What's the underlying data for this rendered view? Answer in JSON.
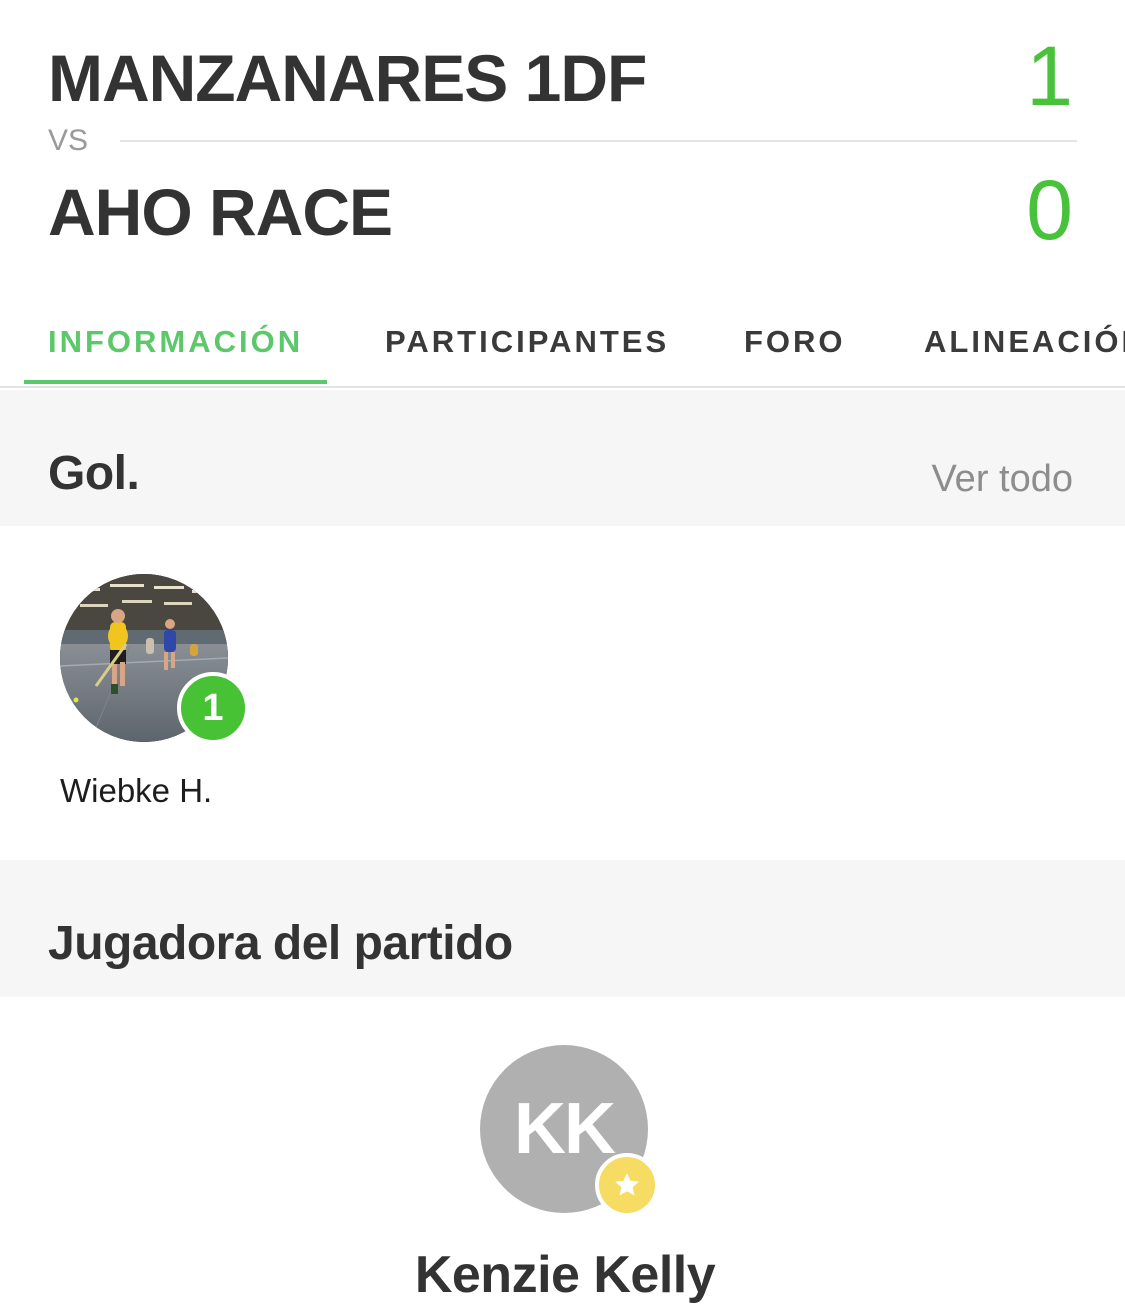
{
  "match": {
    "home_team": "MANZANARES 1DF",
    "home_score": "1",
    "vs_label": "VS",
    "away_team": "AHO RACE",
    "away_score": "0",
    "score_color": "#48c23a"
  },
  "tabs": [
    {
      "label": "INFORMACIÓN",
      "active": true
    },
    {
      "label": "PARTICIPANTES",
      "active": false
    },
    {
      "label": "FORO",
      "active": false
    },
    {
      "label": "ALINEACIÓN",
      "active": false
    }
  ],
  "accent_color": "#5cc86a",
  "goals": {
    "title": "Gol.",
    "see_all": "Ver todo",
    "scorers": [
      {
        "name": "Wiebke H.",
        "goals": "1"
      }
    ]
  },
  "player_of_match": {
    "title": "Jugadora del partido",
    "initials": "KK",
    "name": "Kenzie Kelly",
    "badge_icon": "star-icon",
    "badge_color": "#f6dc62"
  }
}
